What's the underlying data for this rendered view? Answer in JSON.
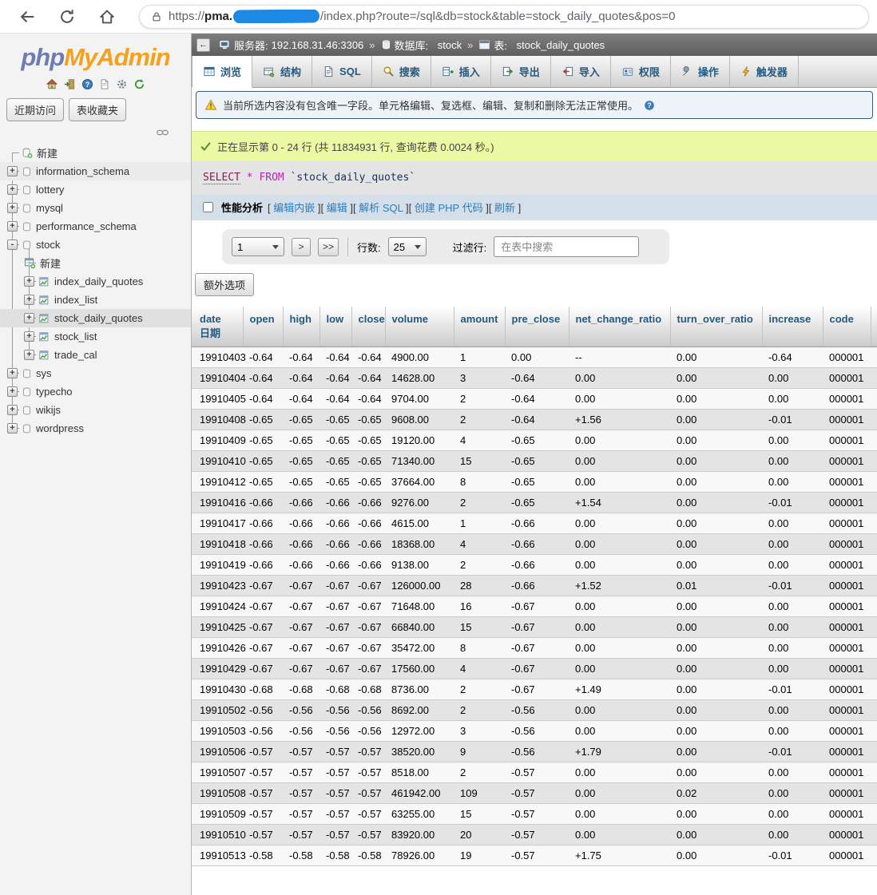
{
  "browser": {
    "url_prefix": "https://",
    "url_host": "pma.",
    "url_path": "/index.php?route=/sql&db=stock&table=stock_daily_quotes&pos=0"
  },
  "sidebar": {
    "logo_php": "php",
    "logo_admin": "MyAdmin",
    "recent_label": "近期访问",
    "favorites_label": "表收藏夹",
    "tree": [
      {
        "label": "新建",
        "icon": "new-database-icon",
        "depth": 0,
        "expander": null
      },
      {
        "label": "information_schema",
        "icon": "database-icon",
        "depth": 0,
        "expander": "+",
        "hover": true
      },
      {
        "label": "lottery",
        "icon": "database-icon",
        "depth": 0,
        "expander": "+"
      },
      {
        "label": "mysql",
        "icon": "database-icon",
        "depth": 0,
        "expander": "+"
      },
      {
        "label": "performance_schema",
        "icon": "database-icon",
        "depth": 0,
        "expander": "+"
      },
      {
        "label": "stock",
        "icon": "database-icon",
        "depth": 0,
        "expander": "-"
      },
      {
        "label": "新建",
        "icon": "new-table-icon",
        "depth": 1,
        "expander": null
      },
      {
        "label": "index_daily_quotes",
        "icon": "table-icon",
        "depth": 1,
        "expander": "+"
      },
      {
        "label": "index_list",
        "icon": "table-icon",
        "depth": 1,
        "expander": "+"
      },
      {
        "label": "stock_daily_quotes",
        "icon": "table-icon",
        "depth": 1,
        "expander": "+",
        "selected": true
      },
      {
        "label": "stock_list",
        "icon": "table-icon",
        "depth": 1,
        "expander": "+"
      },
      {
        "label": "trade_cal",
        "icon": "table-icon",
        "depth": 1,
        "expander": "+"
      },
      {
        "label": "sys",
        "icon": "database-icon",
        "depth": 0,
        "expander": "+"
      },
      {
        "label": "typecho",
        "icon": "database-icon",
        "depth": 0,
        "expander": "+"
      },
      {
        "label": "wikijs",
        "icon": "database-icon",
        "depth": 0,
        "expander": "+"
      },
      {
        "label": "wordpress",
        "icon": "database-icon",
        "depth": 0,
        "expander": "+"
      }
    ]
  },
  "breadcrumb": {
    "collapse_label": "←",
    "server_label": "服务器:",
    "server_value": "192.168.31.46:3306",
    "separator": "»",
    "db_label": "数据库:",
    "db_value": "stock",
    "table_label": "表:",
    "table_value": "stock_daily_quotes"
  },
  "tabs": [
    {
      "label": "浏览",
      "icon": "browse-icon",
      "active": true
    },
    {
      "label": "结构",
      "icon": "structure-icon",
      "active": false
    },
    {
      "label": "SQL",
      "icon": "sql-icon",
      "active": false
    },
    {
      "label": "搜索",
      "icon": "search-icon",
      "active": false
    },
    {
      "label": "插入",
      "icon": "insert-icon",
      "active": false
    },
    {
      "label": "导出",
      "icon": "export-icon",
      "active": false
    },
    {
      "label": "导入",
      "icon": "import-icon",
      "active": false
    },
    {
      "label": "权限",
      "icon": "privileges-icon",
      "active": false
    },
    {
      "label": "操作",
      "icon": "operations-icon",
      "active": false
    },
    {
      "label": "触发器",
      "icon": "triggers-icon",
      "active": false
    }
  ],
  "messages": {
    "warning": "当前所选内容没有包含唯一字段。单元格编辑、复选框、编辑、复制和删除无法正常使用。",
    "success": "正在显示第 0 - 24 行 (共 11834931 行, 查询花费 0.0024 秒。)"
  },
  "sql": {
    "keyword_select": "SELECT",
    "star": "*",
    "keyword_from": "FROM",
    "table_name": "`stock_daily_quotes`"
  },
  "profiling": {
    "label": "性能分析",
    "bracket_open": "[ ",
    "bracket_close": " ]",
    "links": [
      "编辑内嵌",
      "编辑",
      "解析 SQL",
      "创建 PHP 代码",
      "刷新"
    ]
  },
  "pagination": {
    "page_value": "1",
    "next_label": ">",
    "last_label": ">>",
    "rows_label": "行数:",
    "rows_value": "25",
    "filter_label": "过滤行:",
    "filter_placeholder": "在表中搜索"
  },
  "extra_options_label": "额外选项",
  "table": {
    "headers": [
      {
        "name": "date",
        "comment": "日期"
      },
      {
        "name": "open"
      },
      {
        "name": "high"
      },
      {
        "name": "low"
      },
      {
        "name": "close"
      },
      {
        "name": "volume"
      },
      {
        "name": "amount"
      },
      {
        "name": "pre_close"
      },
      {
        "name": "net_change_ratio"
      },
      {
        "name": "turn_over_ratio"
      },
      {
        "name": "increase"
      },
      {
        "name": "code"
      }
    ],
    "rows": [
      [
        "19910403",
        "-0.64",
        "-0.64",
        "-0.64",
        "-0.64",
        "4900.00",
        "1",
        "0.00",
        "--",
        "0.00",
        "-0.64",
        "000001"
      ],
      [
        "19910404",
        "-0.64",
        "-0.64",
        "-0.64",
        "-0.64",
        "14628.00",
        "3",
        "-0.64",
        "0.00",
        "0.00",
        "0.00",
        "000001"
      ],
      [
        "19910405",
        "-0.64",
        "-0.64",
        "-0.64",
        "-0.64",
        "9704.00",
        "2",
        "-0.64",
        "0.00",
        "0.00",
        "0.00",
        "000001"
      ],
      [
        "19910408",
        "-0.65",
        "-0.65",
        "-0.65",
        "-0.65",
        "9608.00",
        "2",
        "-0.64",
        "+1.56",
        "0.00",
        "-0.01",
        "000001"
      ],
      [
        "19910409",
        "-0.65",
        "-0.65",
        "-0.65",
        "-0.65",
        "19120.00",
        "4",
        "-0.65",
        "0.00",
        "0.00",
        "0.00",
        "000001"
      ],
      [
        "19910410",
        "-0.65",
        "-0.65",
        "-0.65",
        "-0.65",
        "71340.00",
        "15",
        "-0.65",
        "0.00",
        "0.00",
        "0.00",
        "000001"
      ],
      [
        "19910412",
        "-0.65",
        "-0.65",
        "-0.65",
        "-0.65",
        "37664.00",
        "8",
        "-0.65",
        "0.00",
        "0.00",
        "0.00",
        "000001"
      ],
      [
        "19910416",
        "-0.66",
        "-0.66",
        "-0.66",
        "-0.66",
        "9276.00",
        "2",
        "-0.65",
        "+1.54",
        "0.00",
        "-0.01",
        "000001"
      ],
      [
        "19910417",
        "-0.66",
        "-0.66",
        "-0.66",
        "-0.66",
        "4615.00",
        "1",
        "-0.66",
        "0.00",
        "0.00",
        "0.00",
        "000001"
      ],
      [
        "19910418",
        "-0.66",
        "-0.66",
        "-0.66",
        "-0.66",
        "18368.00",
        "4",
        "-0.66",
        "0.00",
        "0.00",
        "0.00",
        "000001"
      ],
      [
        "19910419",
        "-0.66",
        "-0.66",
        "-0.66",
        "-0.66",
        "9138.00",
        "2",
        "-0.66",
        "0.00",
        "0.00",
        "0.00",
        "000001"
      ],
      [
        "19910423",
        "-0.67",
        "-0.67",
        "-0.67",
        "-0.67",
        "126000.00",
        "28",
        "-0.66",
        "+1.52",
        "0.01",
        "-0.01",
        "000001"
      ],
      [
        "19910424",
        "-0.67",
        "-0.67",
        "-0.67",
        "-0.67",
        "71648.00",
        "16",
        "-0.67",
        "0.00",
        "0.00",
        "0.00",
        "000001"
      ],
      [
        "19910425",
        "-0.67",
        "-0.67",
        "-0.67",
        "-0.67",
        "66840.00",
        "15",
        "-0.67",
        "0.00",
        "0.00",
        "0.00",
        "000001"
      ],
      [
        "19910426",
        "-0.67",
        "-0.67",
        "-0.67",
        "-0.67",
        "35472.00",
        "8",
        "-0.67",
        "0.00",
        "0.00",
        "0.00",
        "000001"
      ],
      [
        "19910429",
        "-0.67",
        "-0.67",
        "-0.67",
        "-0.67",
        "17560.00",
        "4",
        "-0.67",
        "0.00",
        "0.00",
        "0.00",
        "000001"
      ],
      [
        "19910430",
        "-0.68",
        "-0.68",
        "-0.68",
        "-0.68",
        "8736.00",
        "2",
        "-0.67",
        "+1.49",
        "0.00",
        "-0.01",
        "000001"
      ],
      [
        "19910502",
        "-0.56",
        "-0.56",
        "-0.56",
        "-0.56",
        "8692.00",
        "2",
        "-0.56",
        "0.00",
        "0.00",
        "0.00",
        "000001"
      ],
      [
        "19910503",
        "-0.56",
        "-0.56",
        "-0.56",
        "-0.56",
        "12972.00",
        "3",
        "-0.56",
        "0.00",
        "0.00",
        "0.00",
        "000001"
      ],
      [
        "19910506",
        "-0.57",
        "-0.57",
        "-0.57",
        "-0.57",
        "38520.00",
        "9",
        "-0.56",
        "+1.79",
        "0.00",
        "-0.01",
        "000001"
      ],
      [
        "19910507",
        "-0.57",
        "-0.57",
        "-0.57",
        "-0.57",
        "8518.00",
        "2",
        "-0.57",
        "0.00",
        "0.00",
        "0.00",
        "000001"
      ],
      [
        "19910508",
        "-0.57",
        "-0.57",
        "-0.57",
        "-0.57",
        "461942.00",
        "109",
        "-0.57",
        "0.00",
        "0.02",
        "0.00",
        "000001"
      ],
      [
        "19910509",
        "-0.57",
        "-0.57",
        "-0.57",
        "-0.57",
        "63255.00",
        "15",
        "-0.57",
        "0.00",
        "0.00",
        "0.00",
        "000001"
      ],
      [
        "19910510",
        "-0.57",
        "-0.57",
        "-0.57",
        "-0.57",
        "83920.00",
        "20",
        "-0.57",
        "0.00",
        "0.00",
        "0.00",
        "000001"
      ],
      [
        "19910513",
        "-0.58",
        "-0.58",
        "-0.58",
        "-0.58",
        "78926.00",
        "19",
        "-0.57",
        "+1.75",
        "0.00",
        "-0.01",
        "000001"
      ]
    ]
  },
  "colors": {
    "accent_tab_text": "#235a81",
    "success_bg": "#ebf8a4",
    "profiling_bg": "#d5dfe9",
    "redaction_blue": "#1e88e5",
    "logo_php": "#6e7cb5",
    "logo_admin": "#f5a11c"
  }
}
